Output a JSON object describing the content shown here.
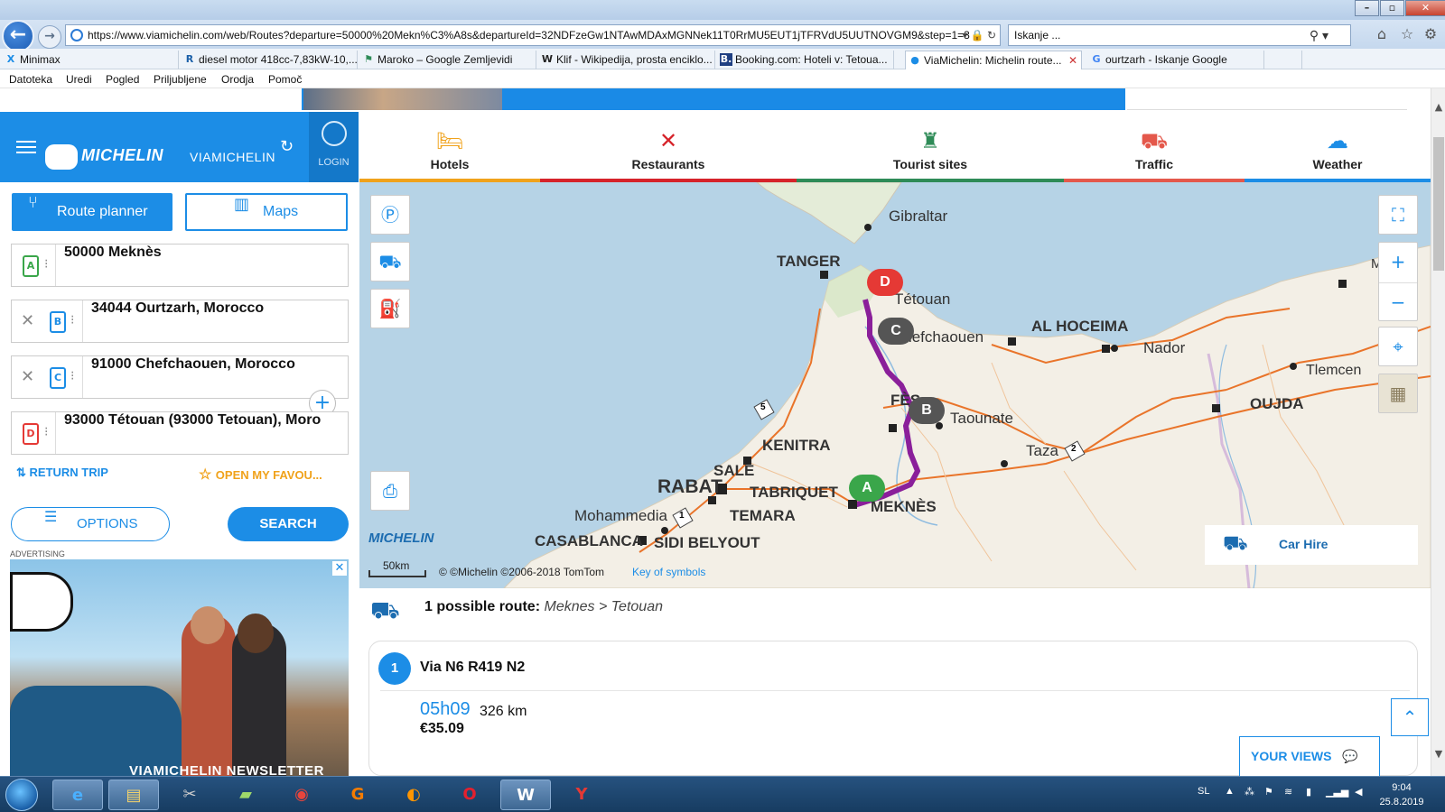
{
  "browser": {
    "url": "https://www.viamichelin.com/web/Routes?departure=50000%20Mekn%C3%A8s&departureId=32NDFzeGw1NTAwMDAxMGNNek11T0RrMU5EUT1jTFRVdU5UUTNOVGM9&step=1=3",
    "search_box": "Iskanje ...",
    "tabs": [
      {
        "icon": "X",
        "label": "Minimax"
      },
      {
        "icon": "R",
        "label": "diesel motor 418cc-7,83kW-10,..."
      },
      {
        "icon": "⚑",
        "label": "Maroko – Google Zemljevidi"
      },
      {
        "icon": "W",
        "label": "Klif - Wikipedija, prosta enciklo..."
      },
      {
        "icon": "B.",
        "label": "Booking.com: Hoteli v: Tetoua..."
      },
      {
        "icon": "●",
        "label": "ViaMichelin: Michelin route..."
      },
      {
        "icon": "G",
        "label": "ourtzarh - Iskanje Google"
      }
    ],
    "menu": [
      "Datoteka",
      "Uredi",
      "Pogled",
      "Priljubljene",
      "Orodja",
      "Pomoč"
    ]
  },
  "header": {
    "brand": "MICHELIN",
    "brand_sub": "VIAMICHELIN",
    "login": "LOGIN"
  },
  "planner": {
    "route_planner": "Route planner",
    "maps": "Maps",
    "waypoints": [
      {
        "letter": "A",
        "value": "50000 Meknès",
        "color": "#3aa64a"
      },
      {
        "letter": "B",
        "value": "34044 Ourtzarh, Morocco",
        "color": "#1c8de6"
      },
      {
        "letter": "C",
        "value": "91000 Chefchaouen, Morocco",
        "color": "#1c8de6"
      },
      {
        "letter": "D",
        "value": "93000 Tétouan (93000 Tetouan), Moro",
        "color": "#e53935"
      }
    ],
    "return_trip": "RETURN TRIP",
    "open_favourites": "OPEN MY FAVOU...",
    "options": "OPTIONS",
    "search": "SEARCH",
    "advertising": "ADVERTISING",
    "ad_text": "VIAMICHELIN NEWSLETTER"
  },
  "categories": [
    {
      "label": "Hotels",
      "icon": "bed-icon",
      "color": "#f0a21b"
    },
    {
      "label": "Restaurants",
      "icon": "fork-knife-icon",
      "color": "#d6232a"
    },
    {
      "label": "Tourist sites",
      "icon": "castle-icon",
      "color": "#2e8b57"
    },
    {
      "label": "Traffic",
      "icon": "car-icon",
      "color": "#e4584b"
    },
    {
      "label": "Weather",
      "icon": "cloud-sun-icon",
      "color": "#1c8de6"
    }
  ],
  "map": {
    "places": [
      "Gibraltar",
      "TANGER",
      "Tétouan",
      "Chefchaouen",
      "AL HOCEIMA",
      "Nador",
      "Melilla",
      "Tlemcen",
      "OUJDA",
      "Taounate",
      "FÈS",
      "Taza",
      "KENITRA",
      "SALE",
      "RABAT",
      "TABRIQUET",
      "TEMARA",
      "Mohammedia",
      "CASABLANCA",
      "SIDI BELYOUT",
      "MEKNÈS"
    ],
    "markers": [
      "A",
      "B",
      "C",
      "D"
    ],
    "scale": "50km",
    "copyright": "© ©Michelin ©2006-2018 TomTom",
    "key_of_symbols": "Key of symbols",
    "logo": "MICHELIN",
    "car_hire": "Car Hire",
    "road_shields": [
      "5",
      "1",
      "2"
    ]
  },
  "routes": {
    "count_label": "1 possible route:",
    "route_desc": "Meknes > Tetouan",
    "items": [
      {
        "num": "1",
        "via": "Via N6 R419 N2",
        "time": "05h09",
        "distance": "326 km",
        "cost": "€35.09"
      }
    ],
    "your_views": "YOUR VIEWS"
  },
  "taskbar": {
    "lang": "SL",
    "time": "9:04",
    "date": "25.8.2019"
  }
}
